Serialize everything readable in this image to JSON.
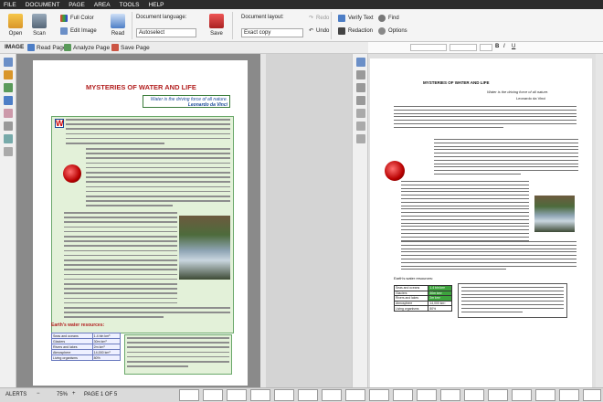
{
  "menu": [
    "FILE",
    "DOCUMENT",
    "PAGE",
    "AREA",
    "TOOLS",
    "HELP"
  ],
  "ribbon": {
    "open": "Open",
    "scan": "Scan",
    "read": "Read",
    "save": "Save",
    "full_color": "Full Color",
    "edit_image": "Edit Image",
    "doc_language_label": "Document language:",
    "doc_language_value": "Autoselect",
    "doc_layout_label": "Document layout:",
    "doc_layout_value": "Exact copy",
    "redo": "Redo",
    "undo": "Undo",
    "verify_text": "Verify Text",
    "find": "Find",
    "redaction": "Redaction",
    "options": "Options"
  },
  "subbar": {
    "image_label": "IMAGE",
    "read_page": "Read Page",
    "analyze_page": "Analyze Page",
    "save_page": "Save Page"
  },
  "image_page": {
    "title": "MYSTERIES OF WATER AND LIFE",
    "motto": "Water is the driving force of all nature.",
    "motto_author": "Leonardo da Vinci",
    "drop_cap": "W",
    "section_heading": "Earth's water resources:",
    "table": [
      [
        "Seas and oceans",
        "1.4 bln km³"
      ],
      [
        "Glaciers",
        "30m km³"
      ],
      [
        "Rivers and lakes",
        "2m km³"
      ],
      [
        "Atmosphere",
        "14,000 km³"
      ],
      [
        "Living organisms",
        "80%"
      ]
    ]
  },
  "text_page": {
    "title": "MYSTERIES OF WATER AND LIFE",
    "motto": "Water is the driving force of all nature.",
    "motto_author": "Leonardo da Vinci",
    "section_heading": "Earth's water resources:",
    "table": [
      [
        "Seas and oceans",
        "1.4 bln km³"
      ],
      [
        "Glaciers",
        "30m km³"
      ],
      [
        "Rivers and lakes",
        "2m km³"
      ],
      [
        "Atmosphere",
        "14,000 km³"
      ],
      [
        "Living organisms",
        "80%"
      ]
    ]
  },
  "status": {
    "alerts": "ALERTS",
    "zoom": "75%",
    "page": "PAGE 1 OF 5"
  },
  "colors": {
    "title_red": "#b21f1f",
    "accent_blue": "#1b4a9a",
    "box_green": "#e3f1d9"
  }
}
